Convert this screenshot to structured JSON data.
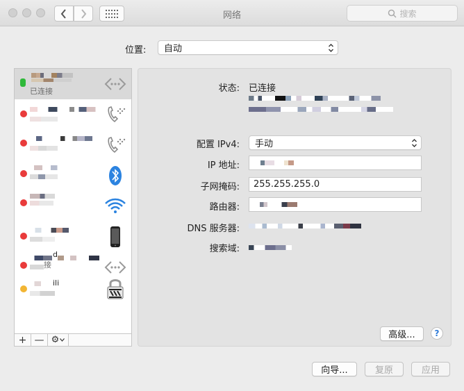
{
  "window": {
    "title": "网络",
    "search_placeholder": "搜索"
  },
  "location": {
    "label": "位置:",
    "value": "自动"
  },
  "sidebar": {
    "services": [
      {
        "status": "connected",
        "status_color": "#2fb93a",
        "subtitle": "已连接",
        "icon": "ethernet-icon",
        "selected": true
      },
      {
        "status": "off",
        "status_color": "#e93b3b",
        "subtitle": "",
        "icon": "modem-phone-icon",
        "selected": false
      },
      {
        "status": "off",
        "status_color": "#e93b3b",
        "subtitle": "",
        "icon": "modem-phone-icon",
        "selected": false
      },
      {
        "status": "off",
        "status_color": "#e93b3b",
        "subtitle": "",
        "icon": "bluetooth-icon",
        "selected": false
      },
      {
        "status": "off",
        "status_color": "#e93b3b",
        "subtitle": "",
        "icon": "wifi-icon",
        "selected": false
      },
      {
        "status": "off",
        "status_color": "#e93b3b",
        "subtitle": "",
        "icon": "iphone-icon",
        "selected": false
      },
      {
        "status": "off",
        "status_color": "#e93b3b",
        "name_fragment": "d",
        "subtitle": "接",
        "icon": "ethernet-icon",
        "selected": false
      },
      {
        "status": "inactive",
        "status_color": "#f2b533",
        "name_fragment": "ili",
        "subtitle": "",
        "icon": "vpn-lock-icon",
        "selected": false
      }
    ],
    "tools": {
      "add": "+",
      "remove": "—",
      "action": "⚙"
    }
  },
  "detail": {
    "status_label": "状态:",
    "status_value": "已连接",
    "ipv4_label": "配置 IPv4:",
    "ipv4_value": "手动",
    "ip_label": "IP 地址:",
    "subnet_label": "子网掩码:",
    "subnet_value": "255.255.255.0",
    "router_label": "路由器:",
    "dns_label": "DNS 服务器:",
    "search_domain_label": "搜索域:",
    "advanced_button": "高级...",
    "help_button": "?"
  },
  "footer": {
    "assistant": "向导...",
    "revert": "复原",
    "apply": "应用"
  },
  "colors": {
    "accent": "#2f7bd8",
    "selected_row": "#d9d9d9"
  }
}
